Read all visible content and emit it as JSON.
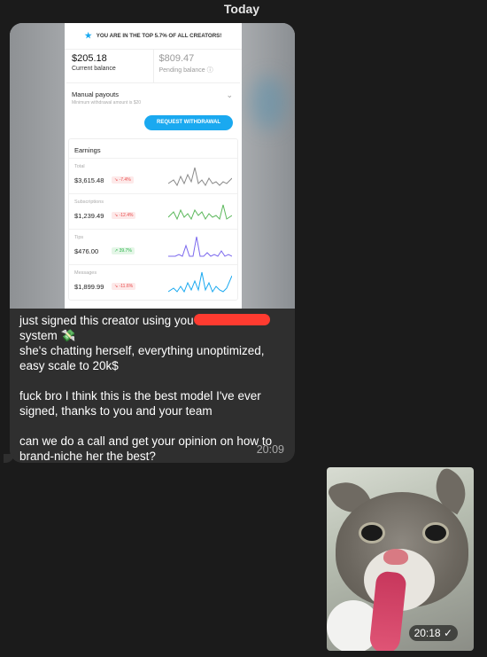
{
  "date_header": "Today",
  "screenshot": {
    "banner": "YOU ARE IN THE TOP 5.7% OF ALL CREATORS!",
    "current_balance": {
      "amount": "$205.18",
      "label": "Current balance"
    },
    "pending_balance": {
      "amount": "$809.47",
      "label": "Pending balance"
    },
    "payout": {
      "title": "Manual payouts",
      "subtitle": "Minimum withdrawal amount is $20",
      "button": "REQUEST WITHDRAWAL"
    },
    "earnings": {
      "heading": "Earnings",
      "rows": [
        {
          "name": "Total",
          "value": "$3,615.48",
          "change": "-7.4%",
          "trend": "down",
          "color": "#8a8a8a"
        },
        {
          "name": "Subscriptions",
          "value": "$1,239.49",
          "change": "-12.4%",
          "trend": "down",
          "color": "#5cb85c"
        },
        {
          "name": "Tips",
          "value": "$476.00",
          "change": "39.7%",
          "trend": "up",
          "color": "#7b68ee"
        },
        {
          "name": "Messages",
          "value": "$1,899.99",
          "change": "-11.6%",
          "trend": "down",
          "color": "#1aa9f0"
        }
      ]
    }
  },
  "message": {
    "line1_before": "just signed this creator using you",
    "line1_after": "system 💸",
    "line2": "she's chatting herself, everything unoptimized, easy scale to 20k$",
    "line3": "fuck bro I think this is the best model I've ever signed, thanks to you and your team",
    "line4": "can we do a call and get your opinion on how to brand-niche her the best?",
    "time": "20:09"
  },
  "image_message": {
    "time": "20:18 ✓"
  },
  "colors": {
    "background": "#1b1b1b",
    "bubble": "#2f2f2f",
    "accent": "#1aa9f0",
    "redaction": "#ff3b30"
  }
}
